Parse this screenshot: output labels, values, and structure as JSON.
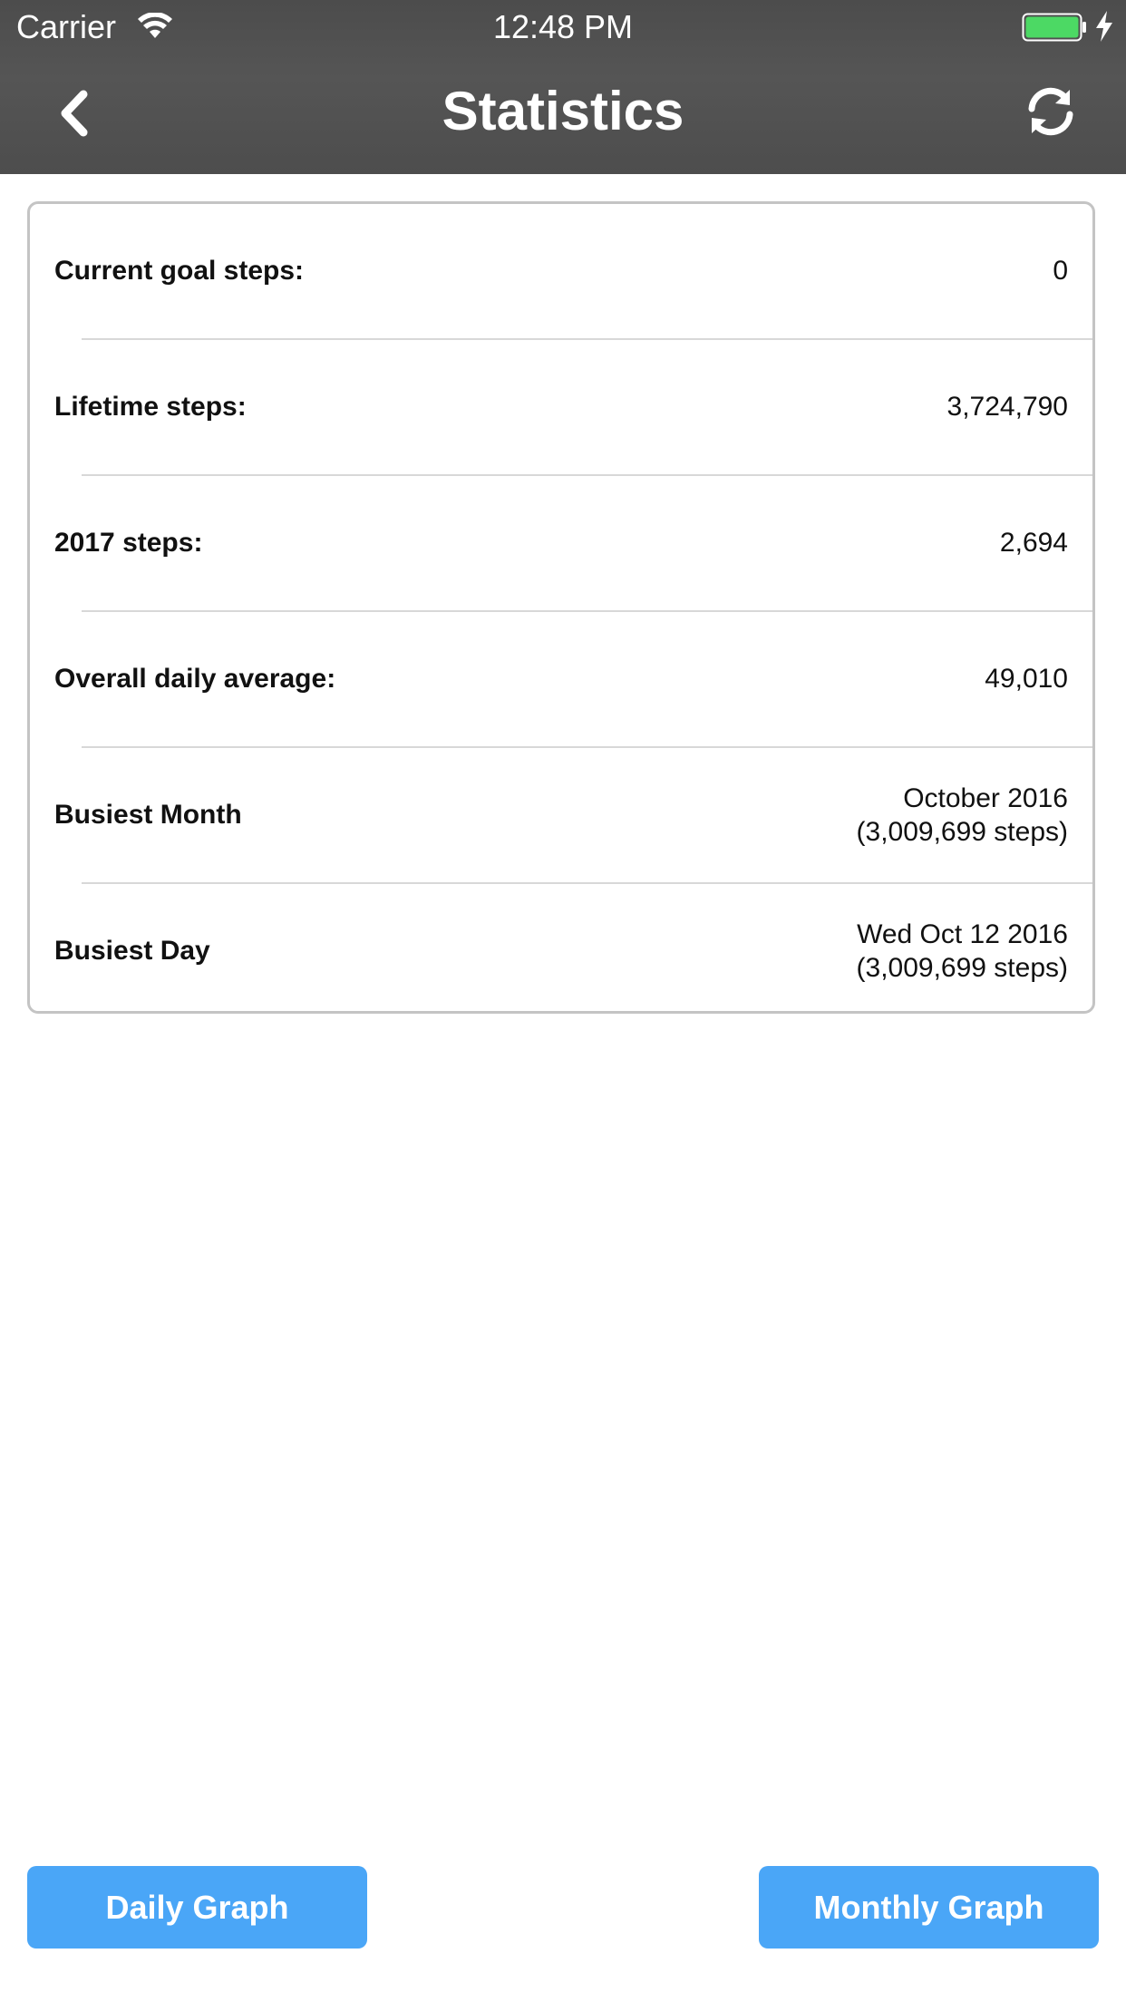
{
  "status_bar": {
    "carrier": "Carrier",
    "time": "12:48 PM",
    "wifi_icon": "wifi-icon",
    "battery_icon": "battery-icon",
    "battery_color": "#4cd964",
    "charging_icon": "charging-bolt-icon"
  },
  "nav": {
    "title": "Statistics",
    "back_icon": "chevron-left-icon",
    "refresh_icon": "refresh-icon"
  },
  "stats": [
    {
      "label": "Current goal steps:",
      "value_line1": "0",
      "value_line2": ""
    },
    {
      "label": "Lifetime steps:",
      "value_line1": "3,724,790",
      "value_line2": ""
    },
    {
      "label": "2017 steps:",
      "value_line1": "2,694",
      "value_line2": ""
    },
    {
      "label": "Overall daily average:",
      "value_line1": "49,010",
      "value_line2": ""
    },
    {
      "label": "Busiest Month",
      "value_line1": "October 2016",
      "value_line2": "(3,009,699 steps)"
    },
    {
      "label": "Busiest Day",
      "value_line1": "Wed Oct 12 2016",
      "value_line2": "(3,009,699 steps)"
    }
  ],
  "buttons": {
    "daily_graph": "Daily Graph",
    "monthly_graph": "Monthly Graph"
  },
  "colors": {
    "header_background": "#555555",
    "button_background": "#4aa6f7",
    "card_border": "#c4c4c4"
  }
}
